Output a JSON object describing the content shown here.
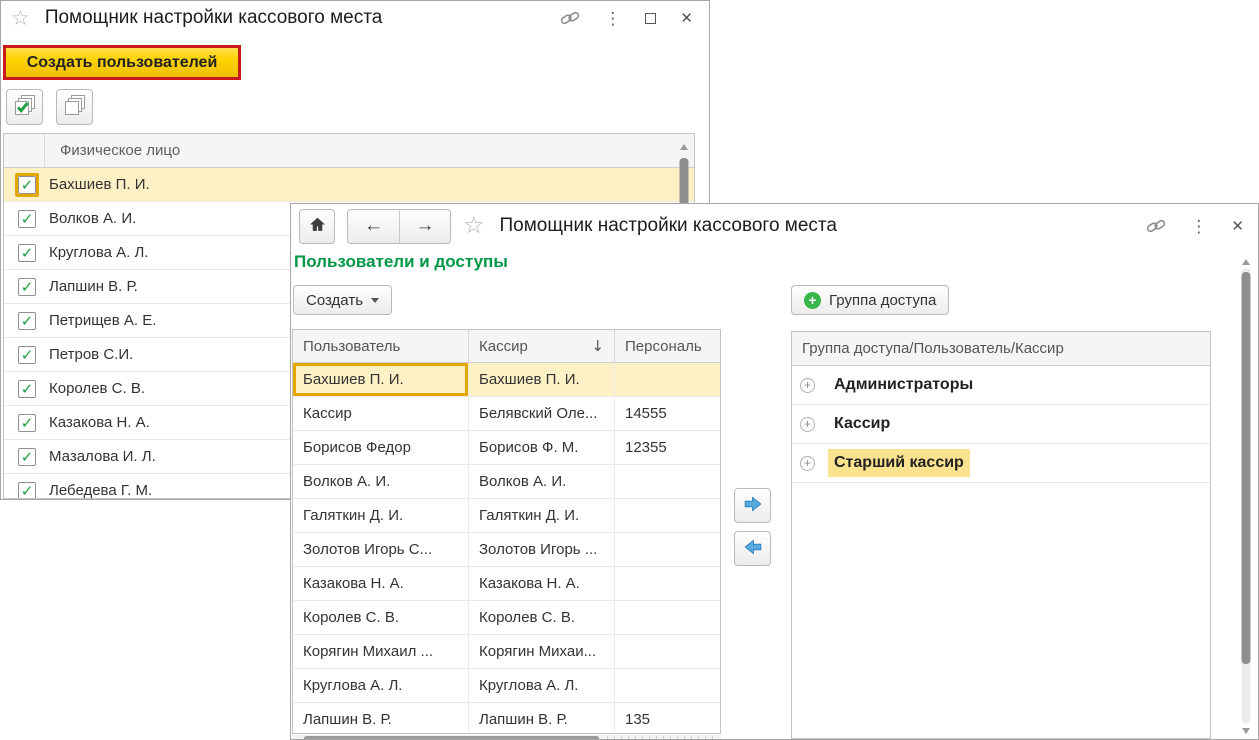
{
  "colors": {
    "heading_green": "#009846",
    "selection_yellow": "#fdf0c5",
    "annotation_red": "#c81a1a",
    "annotation_gold": "#e3a800",
    "annotation_yellow_fill": "#fbe28e",
    "check_green": "#1a9e3f",
    "arrow_blue": "#58aadf"
  },
  "background_window": {
    "title": "Помощник настройки кассового места",
    "create_users_button": "Создать пользователей",
    "table": {
      "header": "Физическое лицо",
      "rows": [
        {
          "name": "Бахшиев П. И.",
          "checked": true,
          "selected": true,
          "checkbox_highlight": true
        },
        {
          "name": "Волков А. И.",
          "checked": true
        },
        {
          "name": "Круглова А. Л.",
          "checked": true
        },
        {
          "name": "Лапшин В. Р.",
          "checked": true
        },
        {
          "name": "Петрищев А. Е.",
          "checked": true
        },
        {
          "name": "Петров С.И.",
          "checked": true
        },
        {
          "name": "Королев С. В.",
          "checked": true
        },
        {
          "name": "Казакова Н. А.",
          "checked": true
        },
        {
          "name": "Мазалова И. Л.",
          "checked": true
        },
        {
          "name": "Лебедева Г. М.",
          "checked": true
        }
      ]
    }
  },
  "foreground_window": {
    "title": "Помощник настройки кассового места",
    "section_heading": "Пользователи и доступы",
    "create_button_label": "Создать",
    "access_group_button_label": "Группа доступа",
    "users_table": {
      "columns": [
        "Пользователь",
        "Кассир",
        "Персональ"
      ],
      "sorted_column": "Кассир",
      "sort_direction": "down",
      "sort_glyph": "↓",
      "rows": [
        {
          "user": "Бахшиев П. И.",
          "cashier": "Бахшиев П. И.",
          "personal": "",
          "selected": true,
          "cell_highlight": true
        },
        {
          "user": "Кассир",
          "cashier": "Белявский Оле...",
          "personal": "14555"
        },
        {
          "user": "Борисов Федор",
          "cashier": "Борисов Ф. М.",
          "personal": "12355"
        },
        {
          "user": "Волков А. И.",
          "cashier": "Волков А. И.",
          "personal": ""
        },
        {
          "user": "Галяткин Д. И.",
          "cashier": "Галяткин Д. И.",
          "personal": ""
        },
        {
          "user": "Золотов Игорь С...",
          "cashier": "Золотов Игорь ...",
          "personal": ""
        },
        {
          "user": "Казакова Н. А.",
          "cashier": "Казакова Н. А.",
          "personal": ""
        },
        {
          "user": "Королев С. В.",
          "cashier": "Королев С. В.",
          "personal": ""
        },
        {
          "user": "Корягин Михаил ...",
          "cashier": "Корягин Михаи...",
          "personal": ""
        },
        {
          "user": "Круглова А. Л.",
          "cashier": "Круглова А. Л.",
          "personal": ""
        },
        {
          "user": "Лапшин В. Р.",
          "cashier": "Лапшин В. Р.",
          "personal": "135"
        }
      ]
    },
    "groups_tree": {
      "header": "Группа доступа/Пользователь/Кассир",
      "rows": [
        {
          "label": "Администраторы"
        },
        {
          "label": "Кассир"
        },
        {
          "label": "Старший кассир",
          "highlighted": true
        }
      ]
    }
  }
}
